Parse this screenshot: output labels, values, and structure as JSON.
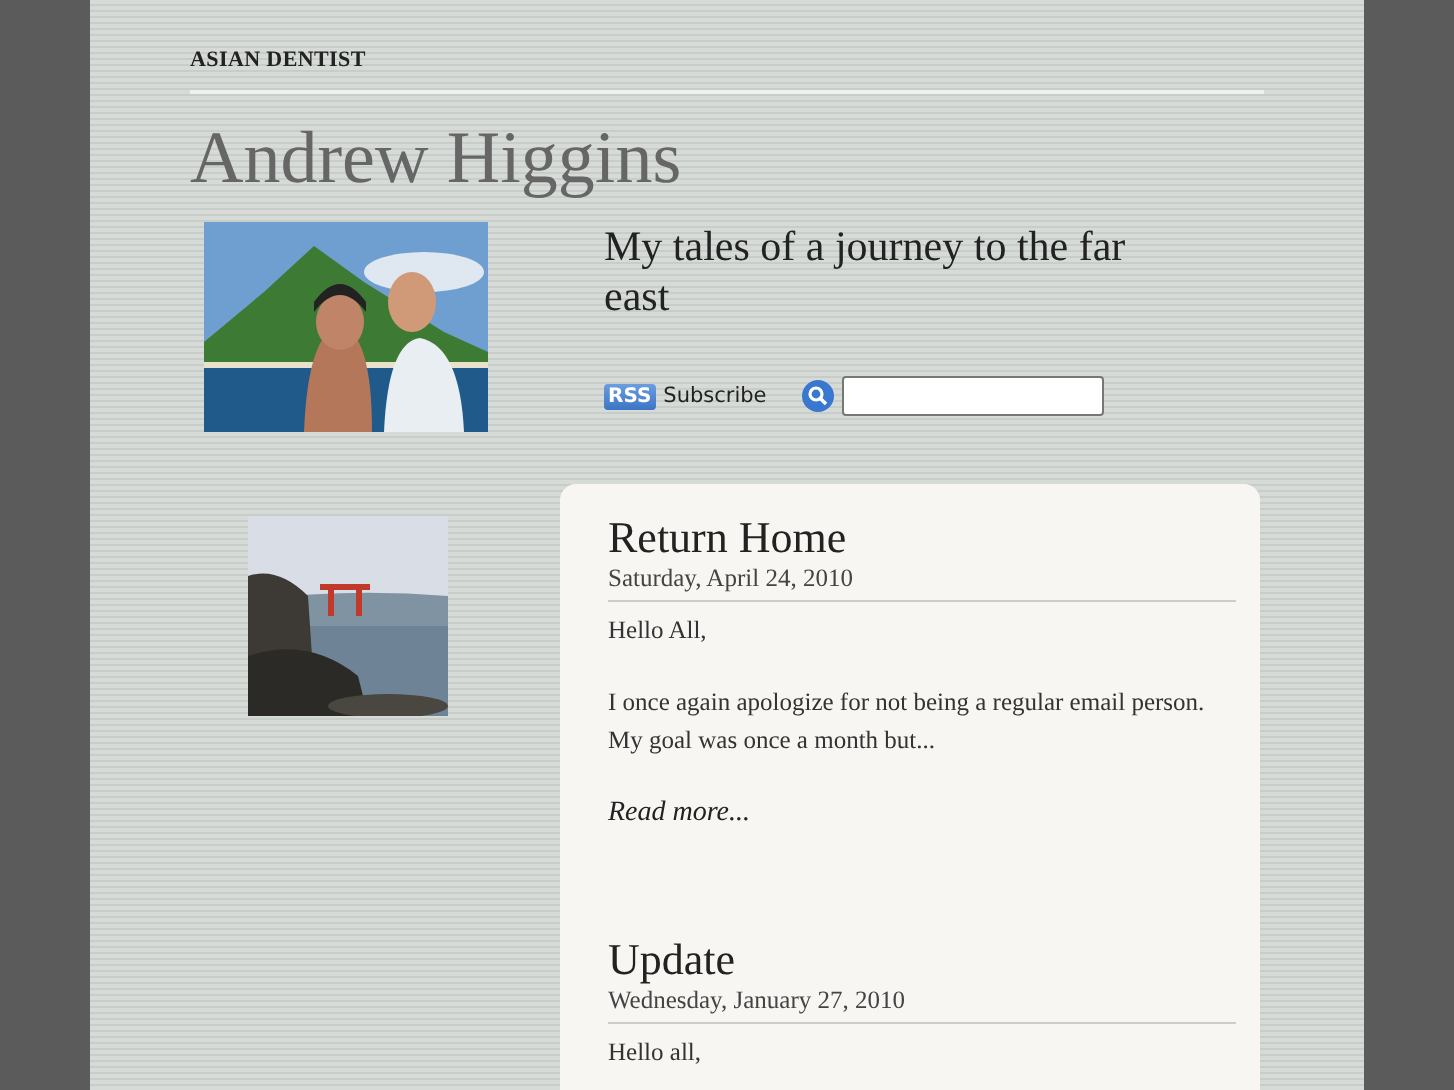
{
  "site_label": "ASIAN DENTIST",
  "blog_title": "Andrew Higgins",
  "tagline": "My tales of a journey to the far east",
  "rss": {
    "badge": "RSS",
    "label": "Subscribe"
  },
  "posts": [
    {
      "title": "Return Home",
      "date": "Saturday, April 24, 2010",
      "paragraphs": [
        "Hello All,",
        "I once again apologize for not being a regular email person. My goal was once a month but..."
      ],
      "read_more": "Read more..."
    },
    {
      "title": "Update",
      "date": "Wednesday, January 27, 2010",
      "paragraphs": [
        "Hello all,"
      ]
    }
  ]
}
